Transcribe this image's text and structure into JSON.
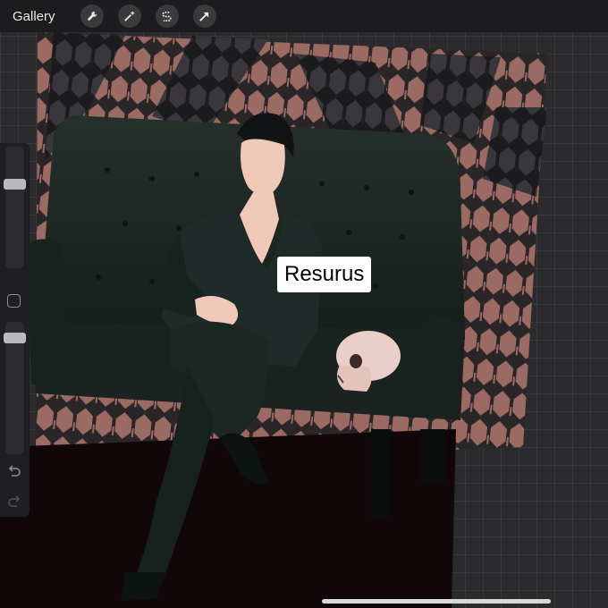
{
  "topbar": {
    "gallery_label": "Gallery",
    "tools": [
      {
        "icon": "wrench-icon"
      },
      {
        "icon": "magic-wand-icon"
      },
      {
        "icon": "selection-s-icon"
      },
      {
        "icon": "transform-arrow-icon"
      }
    ]
  },
  "sidebar": {
    "brush_size_level": 0.15,
    "opacity_level": 0.95,
    "modifier_icon": "square-icon",
    "undo_icon": "undo-icon",
    "redo_icon": "redo-icon"
  },
  "artwork": {
    "text_label": "Resurus"
  },
  "colors": {
    "topbar": "#1c1c1e",
    "canvas_bg": "#2b2b2d",
    "snake_pink": "#9a6a63",
    "sofa_green": "#1f2a25",
    "floor": "#120708"
  }
}
